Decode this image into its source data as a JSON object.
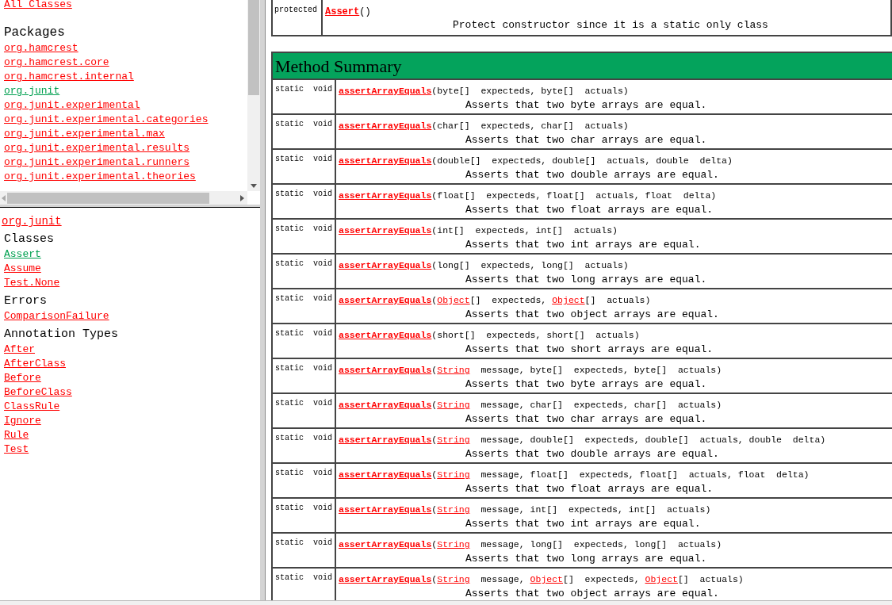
{
  "left_top": {
    "all_classes": "All Classes",
    "packages_heading": "Packages",
    "packages": [
      {
        "label": "org.hamcrest",
        "selected": false
      },
      {
        "label": "org.hamcrest.core",
        "selected": false
      },
      {
        "label": "org.hamcrest.internal",
        "selected": false
      },
      {
        "label": "org.junit",
        "selected": true
      },
      {
        "label": "org.junit.experimental",
        "selected": false
      },
      {
        "label": "org.junit.experimental.categories",
        "selected": false
      },
      {
        "label": "org.junit.experimental.max",
        "selected": false
      },
      {
        "label": "org.junit.experimental.results",
        "selected": false
      },
      {
        "label": "org.junit.experimental.runners",
        "selected": false
      },
      {
        "label": "org.junit.experimental.theories",
        "selected": false
      }
    ]
  },
  "left_bottom": {
    "package_title": "org.junit",
    "sections": [
      {
        "heading": "Classes",
        "items": [
          {
            "label": "Assert",
            "selected": true
          },
          {
            "label": "Assume",
            "selected": false
          },
          {
            "label": "Test.None",
            "selected": false
          }
        ]
      },
      {
        "heading": "Errors",
        "items": [
          {
            "label": "ComparisonFailure",
            "selected": false
          }
        ]
      },
      {
        "heading": "Annotation Types",
        "items": [
          {
            "label": "After",
            "selected": false
          },
          {
            "label": "AfterClass",
            "selected": false
          },
          {
            "label": "Before",
            "selected": false
          },
          {
            "label": "BeforeClass",
            "selected": false
          },
          {
            "label": "ClassRule",
            "selected": false
          },
          {
            "label": "Ignore",
            "selected": false
          },
          {
            "label": "Rule",
            "selected": false
          },
          {
            "label": "Test",
            "selected": false
          }
        ]
      }
    ]
  },
  "constructor": {
    "modifier": "protected",
    "name": "Assert",
    "suffix": "()",
    "description": "Protect constructor since it is a static only class"
  },
  "method_summary": {
    "title": "Method Summary",
    "methods": [
      {
        "modifier": "static  void",
        "name": "assertArrayEquals",
        "params": [
          {
            "kind": "plain",
            "text": "(byte[]  expecteds, byte[]  actuals)"
          }
        ],
        "description": "Asserts that two byte arrays are equal."
      },
      {
        "modifier": "static  void",
        "name": "assertArrayEquals",
        "params": [
          {
            "kind": "plain",
            "text": "(char[]  expecteds, char[]  actuals)"
          }
        ],
        "description": "Asserts that two char arrays are equal."
      },
      {
        "modifier": "static  void",
        "name": "assertArrayEquals",
        "params": [
          {
            "kind": "plain",
            "text": "(double[]  expecteds, double[]  actuals, double  delta)"
          }
        ],
        "description": "Asserts that two double arrays are equal."
      },
      {
        "modifier": "static  void",
        "name": "assertArrayEquals",
        "params": [
          {
            "kind": "plain",
            "text": "(float[]  expecteds, float[]  actuals, float  delta)"
          }
        ],
        "description": "Asserts that two float arrays are equal."
      },
      {
        "modifier": "static  void",
        "name": "assertArrayEquals",
        "params": [
          {
            "kind": "plain",
            "text": "(int[]  expecteds, int[]  actuals)"
          }
        ],
        "description": "Asserts that two int arrays are equal."
      },
      {
        "modifier": "static  void",
        "name": "assertArrayEquals",
        "params": [
          {
            "kind": "plain",
            "text": "(long[]  expecteds, long[]  actuals)"
          }
        ],
        "description": "Asserts that two long arrays are equal."
      },
      {
        "modifier": "static  void",
        "name": "assertArrayEquals",
        "params": [
          {
            "kind": "plain",
            "text": "("
          },
          {
            "kind": "link",
            "text": "Object"
          },
          {
            "kind": "plain",
            "text": "[]  expecteds, "
          },
          {
            "kind": "link",
            "text": "Object"
          },
          {
            "kind": "plain",
            "text": "[]  actuals)"
          }
        ],
        "description": "Asserts that two object arrays are equal."
      },
      {
        "modifier": "static  void",
        "name": "assertArrayEquals",
        "params": [
          {
            "kind": "plain",
            "text": "(short[]  expecteds, short[]  actuals)"
          }
        ],
        "description": "Asserts that two short arrays are equal."
      },
      {
        "modifier": "static  void",
        "name": "assertArrayEquals",
        "params": [
          {
            "kind": "plain",
            "text": "("
          },
          {
            "kind": "link",
            "text": "String"
          },
          {
            "kind": "plain",
            "text": "  message, byte[]  expecteds, byte[]  actuals)"
          }
        ],
        "description": "Asserts that two byte arrays are equal."
      },
      {
        "modifier": "static  void",
        "name": "assertArrayEquals",
        "params": [
          {
            "kind": "plain",
            "text": "("
          },
          {
            "kind": "link",
            "text": "String"
          },
          {
            "kind": "plain",
            "text": "  message, char[]  expecteds, char[]  actuals)"
          }
        ],
        "description": "Asserts that two char arrays are equal."
      },
      {
        "modifier": "static  void",
        "name": "assertArrayEquals",
        "params": [
          {
            "kind": "plain",
            "text": "("
          },
          {
            "kind": "link",
            "text": "String"
          },
          {
            "kind": "plain",
            "text": "  message, double[]  expecteds, double[]  actuals, double  delta)"
          }
        ],
        "description": "Asserts that two double arrays are equal."
      },
      {
        "modifier": "static  void",
        "name": "assertArrayEquals",
        "params": [
          {
            "kind": "plain",
            "text": "("
          },
          {
            "kind": "link",
            "text": "String"
          },
          {
            "kind": "plain",
            "text": "  message, float[]  expecteds, float[]  actuals, float  delta)"
          }
        ],
        "description": "Asserts that two float arrays are equal."
      },
      {
        "modifier": "static  void",
        "name": "assertArrayEquals",
        "params": [
          {
            "kind": "plain",
            "text": "("
          },
          {
            "kind": "link",
            "text": "String"
          },
          {
            "kind": "plain",
            "text": "  message, int[]  expecteds, int[]  actuals)"
          }
        ],
        "description": "Asserts that two int arrays are equal."
      },
      {
        "modifier": "static  void",
        "name": "assertArrayEquals",
        "params": [
          {
            "kind": "plain",
            "text": "("
          },
          {
            "kind": "link",
            "text": "String"
          },
          {
            "kind": "plain",
            "text": "  message, long[]  expecteds, long[]  actuals)"
          }
        ],
        "description": "Asserts that two long arrays are equal."
      },
      {
        "modifier": "static  void",
        "name": "assertArrayEquals",
        "params": [
          {
            "kind": "plain",
            "text": "("
          },
          {
            "kind": "link",
            "text": "String"
          },
          {
            "kind": "plain",
            "text": "  message, "
          },
          {
            "kind": "link",
            "text": "Object"
          },
          {
            "kind": "plain",
            "text": "[]  expecteds, "
          },
          {
            "kind": "link",
            "text": "Object"
          },
          {
            "kind": "plain",
            "text": "[]  actuals)"
          }
        ],
        "description": "Asserts that two object arrays are equal."
      }
    ]
  }
}
